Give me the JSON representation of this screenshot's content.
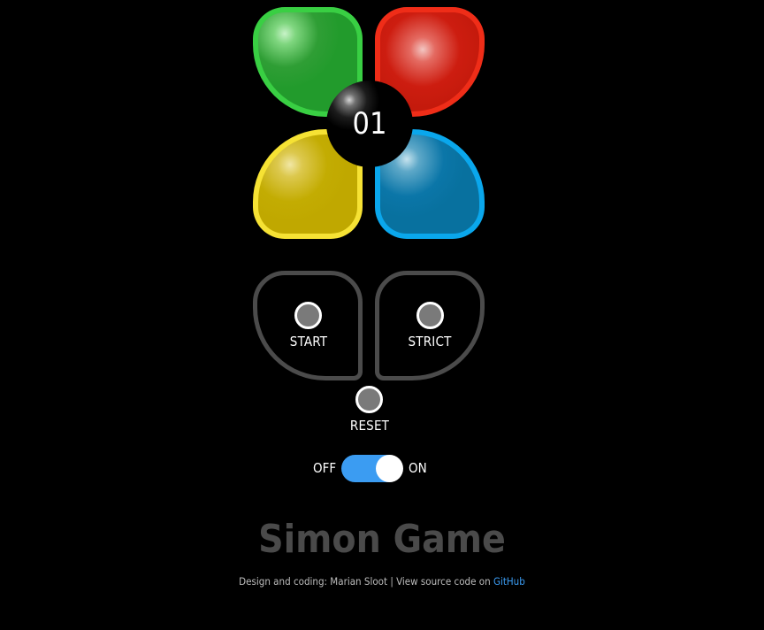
{
  "game": {
    "counter": "01",
    "pads": [
      "green",
      "red",
      "yellow",
      "blue"
    ]
  },
  "controls": {
    "start_label": "START",
    "strict_label": "STRICT",
    "reset_label": "RESET"
  },
  "power": {
    "off_label": "OFF",
    "on_label": "ON",
    "state": "on"
  },
  "title": "Simon Game",
  "footer": {
    "text": "Design and coding: Marian Sloot | View source code on",
    "link_label": "GitHub"
  },
  "colors": {
    "background": "#000000",
    "green": "#229b2c",
    "red": "#c41a0c",
    "yellow": "#c0a800",
    "blue": "#08719f",
    "toggle_accent": "#3b9cf2",
    "control_border": "#4b4b4b",
    "title": "#4a4a4a"
  }
}
